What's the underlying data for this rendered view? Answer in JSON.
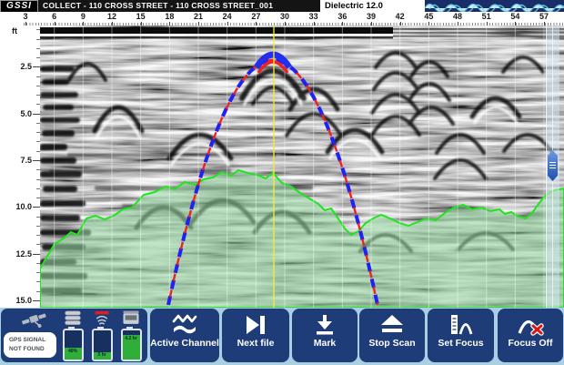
{
  "titlebar": {
    "logo": "GSSI",
    "title": "COLLECT - 110 CROSS STREET - 110 CROSS STREET_001",
    "dielectric_label": "Dielectric 12.0"
  },
  "ruler": {
    "unit_label": "ft",
    "x_ticks": [
      3,
      6,
      9,
      12,
      15,
      18,
      21,
      24,
      27,
      30,
      33,
      36,
      39,
      42,
      45,
      48,
      51,
      54,
      57
    ],
    "y_ticks": [
      "2.5",
      "5.0",
      "7.5",
      "10.0",
      "12.5",
      "15.0"
    ]
  },
  "status_panel": {
    "gps_line1": "GPS SIGNAL",
    "gps_line2": "NOT FOUND",
    "indicators": [
      {
        "id": "storage",
        "icon": "disk-stack-icon",
        "battery_pct": 42,
        "label": "40%"
      },
      {
        "id": "antenna",
        "icon": "antenna-icon",
        "battery_pct": 24,
        "label": "3 hr"
      },
      {
        "id": "control-unit",
        "icon": "control-unit-icon",
        "battery_pct": 85,
        "label": "4.2 hr"
      }
    ]
  },
  "toolbar": {
    "buttons": [
      {
        "id": "active-channel",
        "label": "Active Channel",
        "icon": "waves-icon"
      },
      {
        "id": "next-file",
        "label": "Next file",
        "icon": "skip-next-icon"
      },
      {
        "id": "mark",
        "label": "Mark",
        "icon": "mark-down-arrow-icon"
      },
      {
        "id": "stop-scan",
        "label": "Stop Scan",
        "icon": "eject-triangle-icon"
      },
      {
        "id": "set-focus",
        "label": "Set Focus",
        "icon": "ruler-hyperbola-icon"
      },
      {
        "id": "focus-off",
        "label": "Focus Off",
        "icon": "hyperbola-x-icon"
      }
    ]
  },
  "colors": {
    "navy_button": "#1e3c78",
    "toolbar_bg": "#a8d0e2",
    "cursor_yellow": "#f5ec3d",
    "pick_green": "#21e421",
    "hyperbola_blue": "#2222ee",
    "hyperbola_red": "#ee2222",
    "scope_bg": "#1b2d68",
    "scope_wave": "#3fc9e8",
    "battery_green": "#2fae3a"
  },
  "chart_data": {
    "type": "heatmap",
    "description": "GPR B-scan radargram, grayscale amplitude with picked layer (green) and operator-fitted dashed hyperbola",
    "x_axis": {
      "unit": "ft",
      "ticks": [
        3,
        6,
        9,
        12,
        15,
        18,
        21,
        24,
        27,
        30,
        33,
        36,
        39,
        42,
        45,
        48,
        51,
        54,
        57
      ],
      "tick_interval_ft": 3
    },
    "depth_axis": {
      "label": "ft",
      "ticks": [
        2.5,
        5.0,
        7.5,
        10.0,
        12.5,
        15.0
      ],
      "max_ft": 15.0
    },
    "dielectric": 12.0,
    "cursor_line_distance_ft": 28.9,
    "fitted_hyperbola": {
      "apex_distance_ft": 28.7,
      "apex_depth_ft": 2.1
    },
    "green_pick_depth_range_ft": [
      7.9,
      13.3
    ]
  }
}
